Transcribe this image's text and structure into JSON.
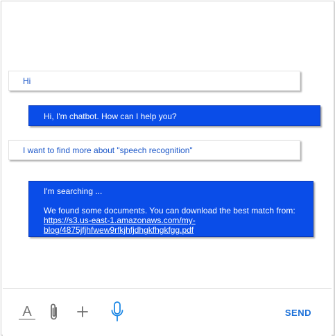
{
  "conversation": {
    "messages": [
      {
        "sender": "user",
        "text": "Hi"
      },
      {
        "sender": "bot",
        "text": "Hi, I'm chatbot. How can I help you?"
      },
      {
        "sender": "user",
        "text": "I want to find more about \"speech recognition\""
      },
      {
        "sender": "bot",
        "line1": "I'm searching ...",
        "line2": "We found some documents. You can download the best match from:",
        "link_line1": "https://s3.us-east-1.amazonaws.com/my-",
        "link_line2": "blog/4875jfjhfwew9rfkjhfjdhgkfhgkfgg.pdf"
      }
    ]
  },
  "toolbar": {
    "format_icon": "text-format-icon",
    "attach_icon": "paperclip-icon",
    "add_icon": "plus-icon",
    "mic_icon": "microphone-icon",
    "send_label": "SEND"
  },
  "colors": {
    "accent": "#1a6fd8",
    "bot_bubble": "#0a4de8",
    "user_text": "#1a56c8",
    "mic": "#1e88e5",
    "icon_gray": "#757575"
  }
}
